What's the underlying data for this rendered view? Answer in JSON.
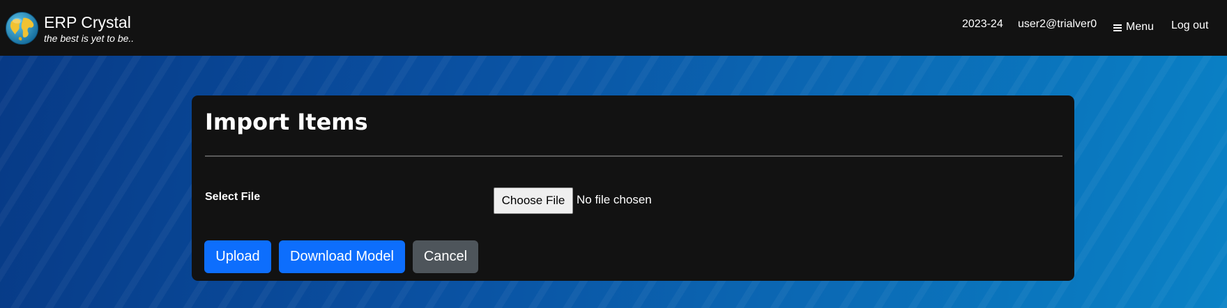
{
  "app": {
    "title": "ERP Crystal",
    "tagline": "the best is yet to be.."
  },
  "nav": {
    "fiscal_year": "2023-24",
    "user": "user2@trialver0",
    "menu_label": "Menu",
    "logout_label": "Log out"
  },
  "form": {
    "title": "Import Items",
    "select_file_label": "Select File",
    "choose_file_label": "Choose File",
    "file_status": "No file chosen",
    "upload_label": "Upload",
    "download_model_label": "Download Model",
    "cancel_label": "Cancel"
  },
  "colors": {
    "navbar": "#121212",
    "card": "#121212",
    "primary": "#0d6efd",
    "secondary": "#4e555b"
  },
  "icons": {
    "logo": "globe-icon",
    "menu": "hamburger-icon"
  }
}
